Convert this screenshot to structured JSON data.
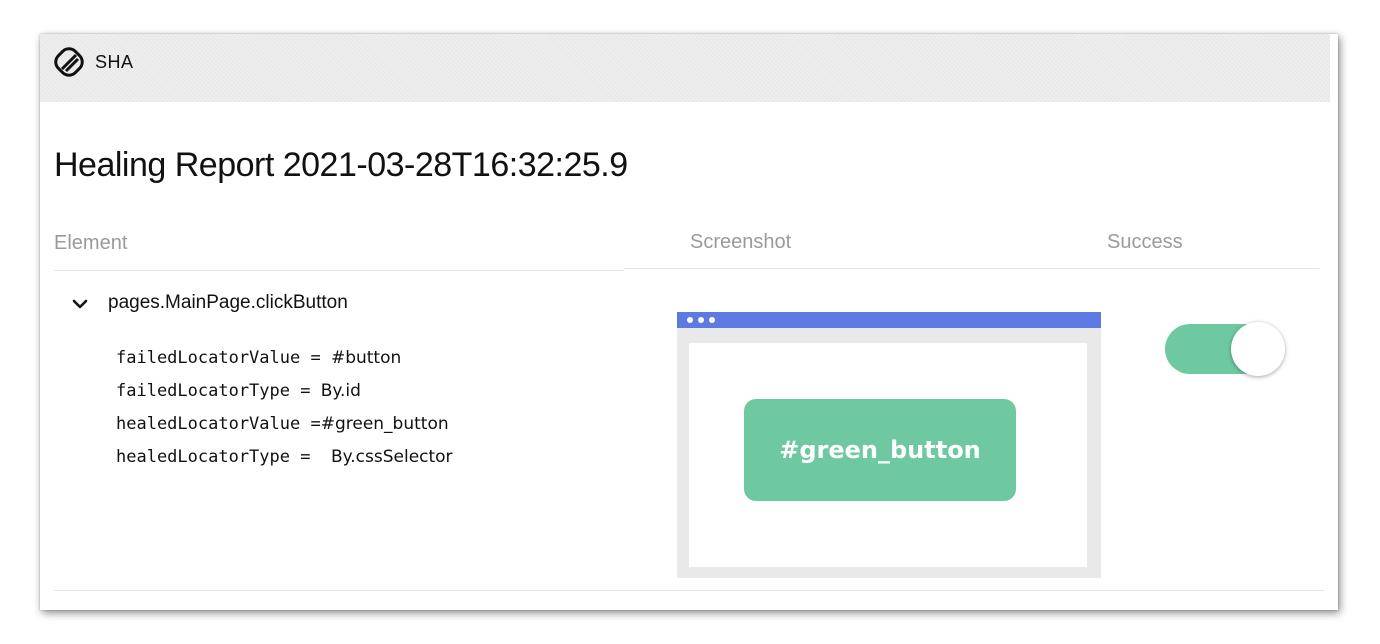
{
  "app": {
    "brand": "SHA",
    "logo_icon": "chain-link-icon"
  },
  "report": {
    "title": "Healing Report 2021-03-28T16:32:25.9"
  },
  "table": {
    "columns": {
      "element": "Element",
      "screenshot": "Screenshot",
      "success": "Success"
    },
    "rows": [
      {
        "element_name": "pages.MainPage.clickButton",
        "expanded": true,
        "properties": [
          {
            "key": "failedLocatorValue",
            "sep": " = ",
            "value": "#button"
          },
          {
            "key": "failedLocatorType",
            "sep": " = ",
            "value": "By.id"
          },
          {
            "key": "healedLocatorValue",
            "sep": " =",
            "value": "#green_button"
          },
          {
            "key": "healedLocatorType",
            "sep": " =  ",
            "value": "By.cssSelector"
          }
        ],
        "screenshot": {
          "button_label": "#green_button"
        },
        "success": true
      }
    ]
  },
  "colors": {
    "accent_green": "#6ec9a1",
    "browser_bar": "#5f79e3",
    "header_text": "#9a9a9a"
  }
}
